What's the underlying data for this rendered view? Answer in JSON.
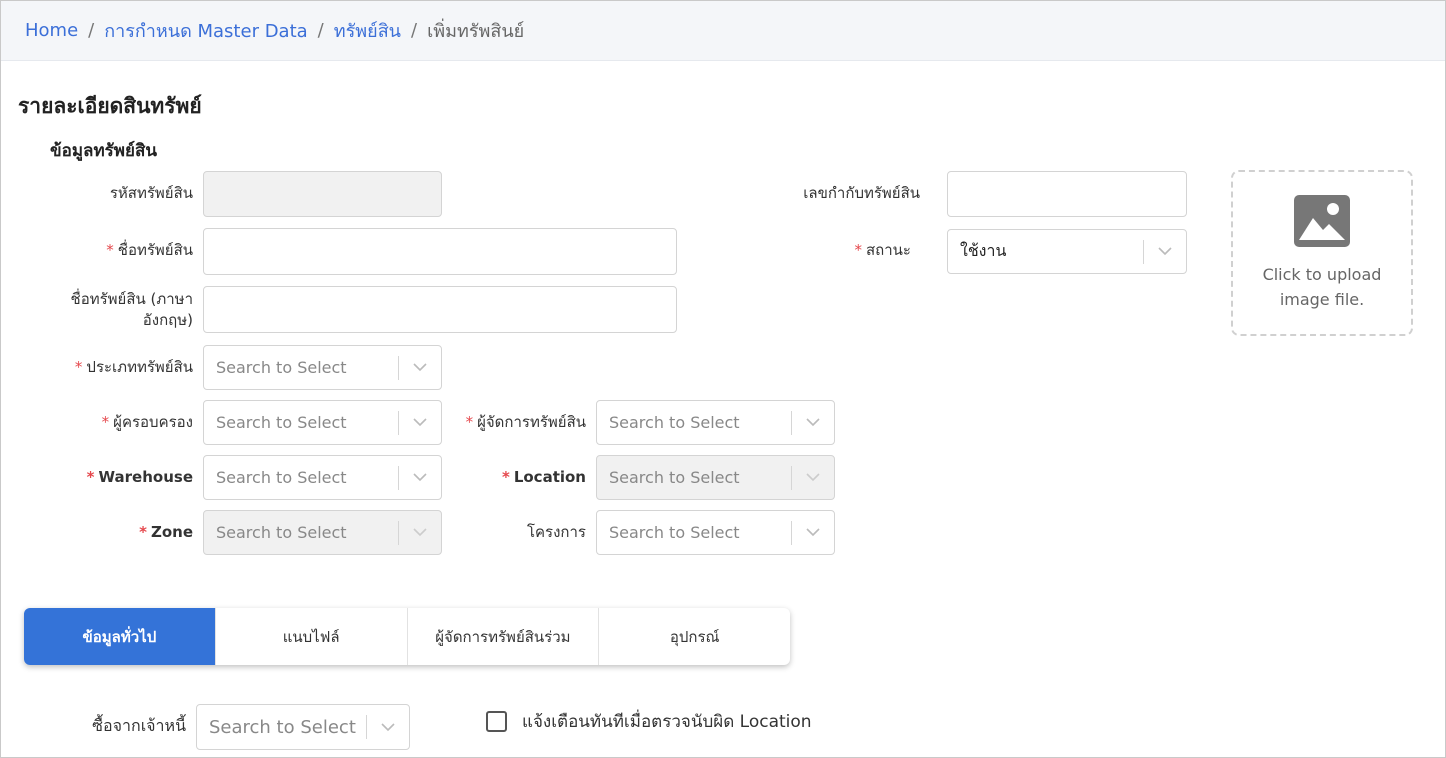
{
  "breadcrumb": {
    "items": [
      "Home",
      "การกำหนด Master Data",
      "ทรัพย์สิน"
    ],
    "current": "เพิ่มทรัพสินย์",
    "separator": "/"
  },
  "page": {
    "title": "รายละเอียดสินทรัพย์",
    "section_title": "ข้อมูลทรัพย์สิน"
  },
  "form": {
    "asset_code_label": "รหัสทรัพย์สิน",
    "asset_tag_label": "เลขกำกับทรัพย์สิน",
    "asset_name_label": "ชื่อทรัพย์สิน",
    "asset_name_en_label_1": "ชื่อทรัพย์สิน (ภาษา",
    "asset_name_en_label_2": "อังกฤษ)",
    "status_label": "สถานะ",
    "status_value": "ใช้งาน",
    "asset_type_label": "ประเภททรัพย์สิน",
    "owner_label": "ผู้ครอบครอง",
    "manager_label": "ผู้จัดการทรัพย์สิน",
    "warehouse_label": "Warehouse",
    "location_label": "Location",
    "zone_label": "Zone",
    "project_label": "โครงการ",
    "creditor_label": "ซื้อจากเจ้าหนี้",
    "select_placeholder": "Search to Select",
    "required_mark": "*"
  },
  "upload": {
    "line1": "Click to upload",
    "line2": "image file."
  },
  "tabs": [
    "ข้อมูลทั่วไป",
    "แนบไฟล์",
    "ผู้จัดการทรัพย์สินร่วม",
    "อุปกรณ์"
  ],
  "alert_checkbox": {
    "label": "แจ้งเตือนทันทีเมื่อตรวจนับผิด Location",
    "checked": false
  },
  "colors": {
    "primary": "#3473d8",
    "link": "#3b6fd8",
    "required": "#e5484d"
  },
  "icons": {
    "chevron": "chevron-down-icon",
    "upload": "image-icon"
  }
}
